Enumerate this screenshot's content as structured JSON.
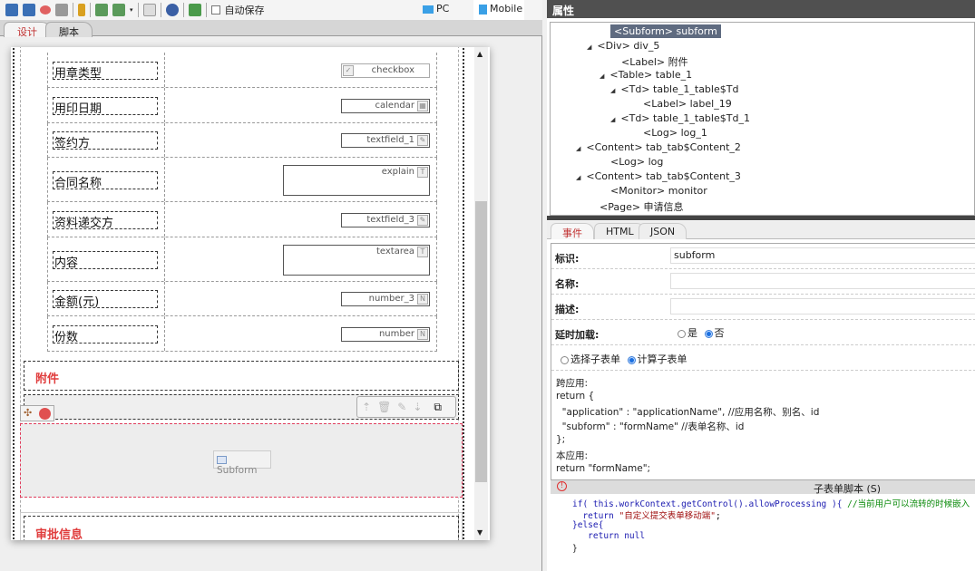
{
  "toolbar": {
    "autosave_label": "自动保存",
    "device_pc": "PC",
    "device_mobile": "Mobile"
  },
  "designer_tabs": [
    "设计",
    "脚本"
  ],
  "form": {
    "rows": [
      {
        "label": "用章类型",
        "field": "checkbox",
        "kind": "checkbox"
      },
      {
        "label": "用印日期",
        "field": "calendar",
        "kind": "calendar"
      },
      {
        "label": "签约方",
        "field": "textfield_1",
        "kind": "textfield"
      },
      {
        "label": "合同名称",
        "field": "explain",
        "kind": "textarea"
      },
      {
        "label": "资料递交方",
        "field": "textfield_3",
        "kind": "textfield"
      },
      {
        "label": "内容",
        "field": "textarea",
        "kind": "textarea"
      },
      {
        "label": "金额(元)",
        "field": "number_3",
        "kind": "number"
      },
      {
        "label": "份数",
        "field": "number",
        "kind": "number"
      }
    ],
    "attachment_title": "附件",
    "subform_label": "Subform",
    "approval_title": "审批信息",
    "accent_color": "#e03c3c"
  },
  "properties": {
    "title": "属性",
    "tree": [
      {
        "text": "<Subform> subform",
        "selected": true
      },
      {
        "text": "<Div> div_5",
        "toggle": true
      },
      {
        "text": "<Label> 附件"
      },
      {
        "text": "<Table> table_1",
        "toggle": true
      },
      {
        "text": "<Td> table_1_table$Td",
        "toggle": true
      },
      {
        "text": "<Label> label_19"
      },
      {
        "text": "<Td> table_1_table$Td_1",
        "toggle": true
      },
      {
        "text": "<Log> log_1"
      },
      {
        "text": "<Content> tab_tab$Content_2",
        "toggle": true
      },
      {
        "text": "<Log> log"
      },
      {
        "text": "<Content> tab_tab$Content_3",
        "toggle": true
      },
      {
        "text": "<Monitor> monitor"
      },
      {
        "text": "<Page> 申请信息"
      }
    ],
    "tabs": [
      "事件",
      "HTML",
      "JSON"
    ],
    "fields": {
      "id_label": "标识:",
      "id_value": "subform",
      "name_label": "名称:",
      "name_value": "",
      "desc_label": "描述:",
      "desc_value": "",
      "lazy_label": "延时加载:",
      "lazy_yes": "是",
      "lazy_no": "否",
      "select_subform": "选择子表单",
      "script_subform": "计算子表单"
    },
    "help": [
      "跨应用:",
      "return {",
      "  \"application\" : \"applicationName\", //应用名称、别名、id",
      "  \"subform\" : \"formName\" //表单名称、id",
      "};",
      "本应用:",
      "return \"formName\";"
    ],
    "script_title": "子表单脚本 (S)",
    "code": {
      "l1a": "if( this.workContext.getControl().allowProcessing ){ ",
      "l1b": "//当前用户可以流转的时候嵌入",
      "l2a": "  return ",
      "l2b": "\"自定义提交表单移动端\"",
      "l2c": ";",
      "l3": "}else{",
      "l4": "   return null",
      "l5": "}"
    }
  }
}
